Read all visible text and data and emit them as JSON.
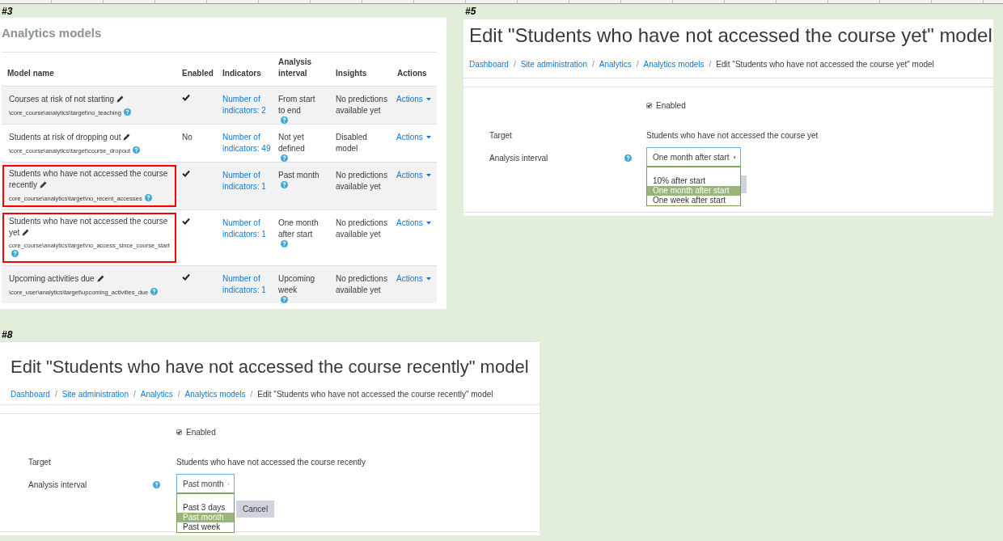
{
  "models_list": {
    "label": "#3",
    "title": "Analytics models",
    "columns": [
      "Model name",
      "Enabled",
      "Indicators",
      "Analysis interval",
      "Insights",
      "Actions"
    ],
    "rows": [
      {
        "name": "Courses at risk of not starting",
        "target": "\\core_course\\analytics\\target\\no_teaching",
        "enabled": true,
        "indicators": "Number of indicators: 2",
        "interval": "From start to end",
        "insights": "No predictions available yet",
        "actions": "Actions",
        "highlighted": false
      },
      {
        "name": "Students at risk of dropping out",
        "target": "\\core_course\\analytics\\target\\course_dropout",
        "enabled": false,
        "enabled_text": "No",
        "indicators": "Number of indicators: 49",
        "interval": "Not yet defined",
        "insights": "Disabled model",
        "actions": "Actions",
        "highlighted": false
      },
      {
        "name": "Students who have not accessed the course recently",
        "target": "core_course\\analytics\\target\\no_recent_accesses",
        "enabled": true,
        "indicators": "Number of indicators: 1",
        "interval": "Past month",
        "insights": "No predictions available yet",
        "actions": "Actions",
        "highlighted": true
      },
      {
        "name": "Students who have not accessed the course yet",
        "target": "core_course\\analytics\\target\\no_access_since_course_start",
        "enabled": true,
        "indicators": "Number of indicators: 1",
        "interval": "One month after start",
        "insights": "No predictions available yet",
        "actions": "Actions",
        "highlighted": true
      },
      {
        "name": "Upcoming activities due",
        "target": "\\core_user\\analytics\\target\\upcoming_activities_due",
        "enabled": true,
        "indicators": "Number of indicators: 1",
        "interval": "Upcoming week",
        "insights": "No predictions available yet",
        "actions": "Actions",
        "highlighted": false
      }
    ]
  },
  "edit_yet": {
    "label": "#5",
    "title": "Edit \"Students who have not accessed the course yet\" model",
    "breadcrumbs": [
      {
        "label": "Dashboard",
        "link": true
      },
      {
        "separator": "/",
        "label": "Site administration",
        "link": true
      },
      {
        "separator": "/",
        "label": "Analytics",
        "link": true
      },
      {
        "separator": "/",
        "label": "Analytics models",
        "link": true
      },
      {
        "separator": "/",
        "label": "Edit \"Students who have not accessed the course yet\" model",
        "link": false
      }
    ],
    "enabled_label": "Enabled",
    "enabled_checked": true,
    "target_label": "Target",
    "target_value": "Students who have not accessed the course yet",
    "interval_label": "Analysis interval",
    "interval_value": "One month after start",
    "options": [
      {
        "label": "10% after start",
        "selected": false
      },
      {
        "label": "One month after start",
        "selected": true
      },
      {
        "label": "One week after start",
        "selected": false
      }
    ],
    "button": {
      "covered": true
    }
  },
  "edit_recently": {
    "label": "#8",
    "title": "Edit \"Students who have not accessed the course recently\" model",
    "breadcrumbs": [
      {
        "label": "Dashboard",
        "link": true
      },
      {
        "separator": "/",
        "label": "Site administration",
        "link": true
      },
      {
        "separator": "/",
        "label": "Analytics",
        "link": true
      },
      {
        "separator": "/",
        "label": "Analytics models",
        "link": true
      },
      {
        "separator": "/",
        "label": "Edit \"Students who have not accessed the course recently\" model",
        "link": false
      }
    ],
    "enabled_label": "Enabled",
    "enabled_checked": true,
    "target_label": "Target",
    "target_value": "Students who have not accessed the course recently",
    "interval_label": "Analysis interval",
    "interval_value": "Past month",
    "options": [
      {
        "label": "Past 3 days",
        "selected": false
      },
      {
        "label": "Past month",
        "selected": true
      },
      {
        "label": "Past week",
        "selected": false
      }
    ],
    "button": {
      "covered": false,
      "label": "Cancel"
    }
  }
}
